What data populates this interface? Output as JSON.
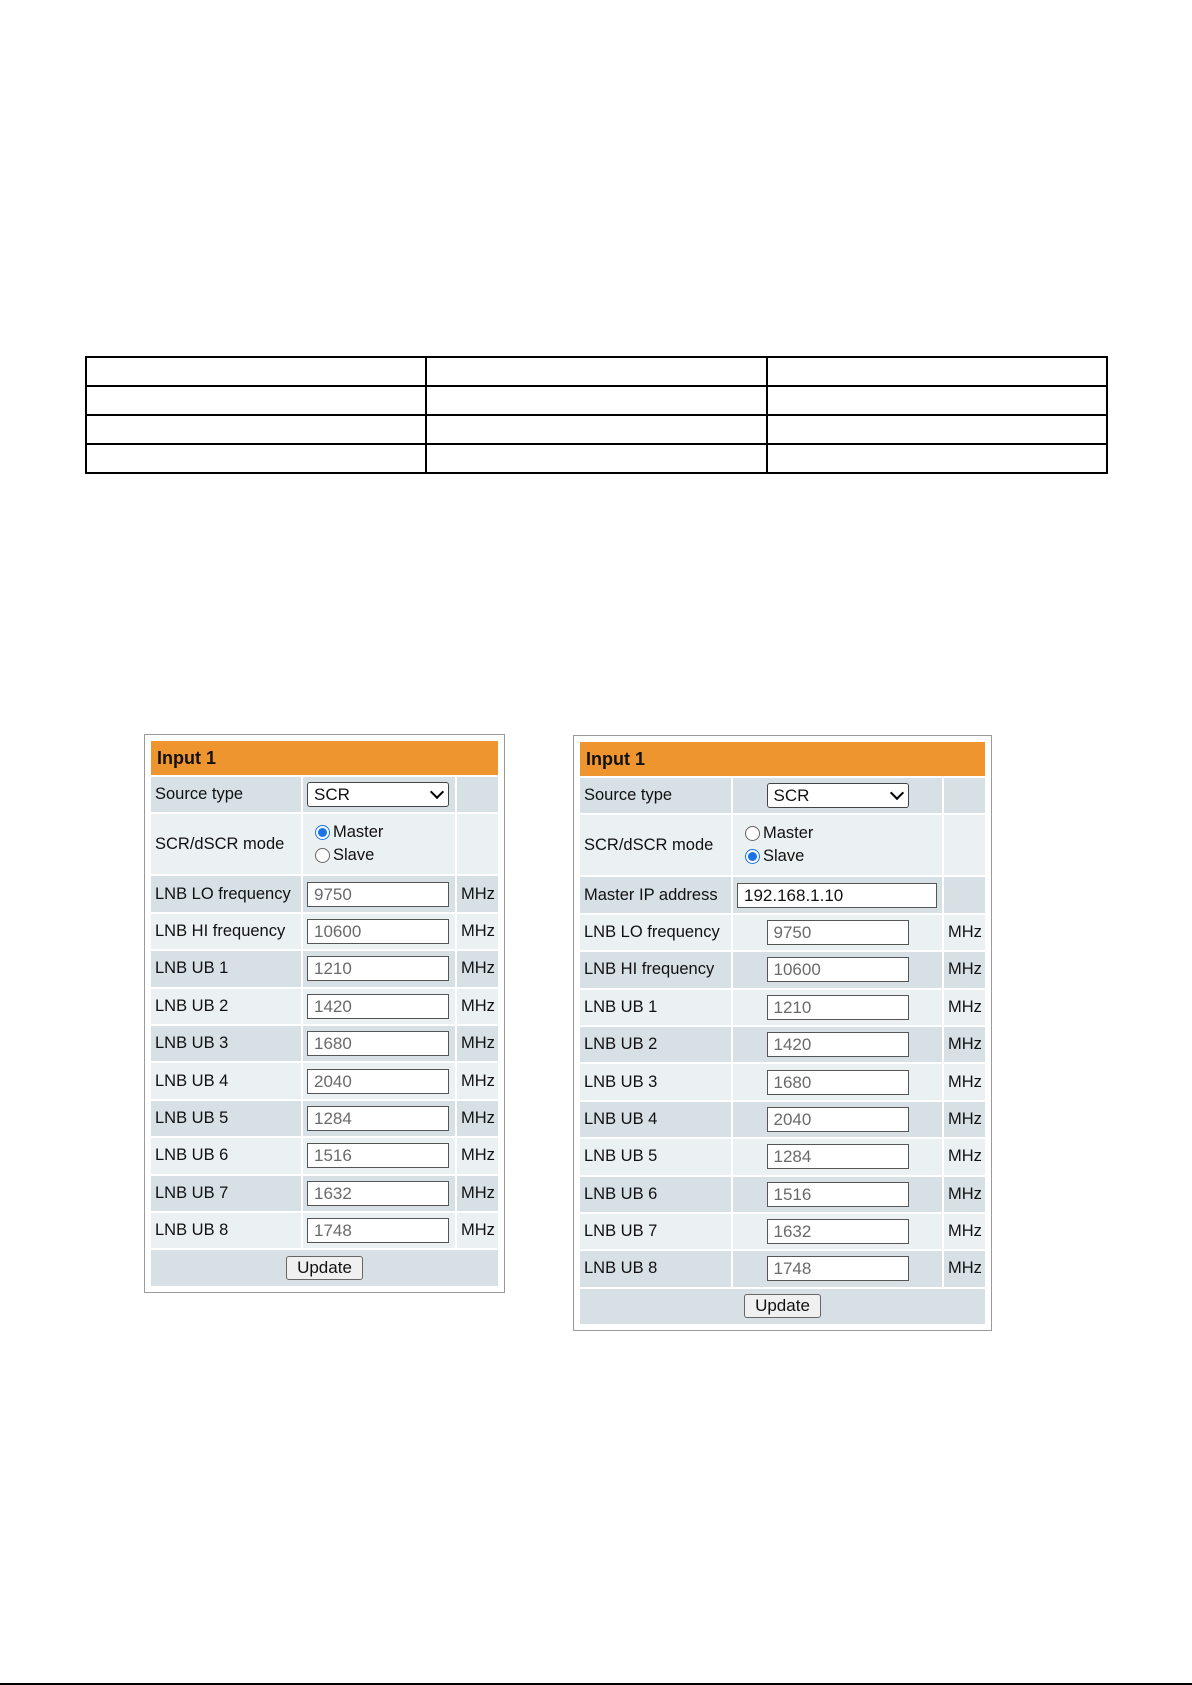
{
  "left_panel": {
    "title": "Input 1",
    "source_type": {
      "label": "Source type",
      "value": "SCR"
    },
    "mode": {
      "label": "SCR/dSCR mode",
      "options": [
        "Master",
        "Slave"
      ],
      "selected": "Master"
    },
    "rows": [
      {
        "label": "LNB LO frequency",
        "value": "9750",
        "unit": "MHz"
      },
      {
        "label": "LNB HI frequency",
        "value": "10600",
        "unit": "MHz"
      },
      {
        "label": "LNB UB 1",
        "value": "1210",
        "unit": "MHz"
      },
      {
        "label": "LNB UB 2",
        "value": "1420",
        "unit": "MHz"
      },
      {
        "label": "LNB UB 3",
        "value": "1680",
        "unit": "MHz"
      },
      {
        "label": "LNB UB 4",
        "value": "2040",
        "unit": "MHz"
      },
      {
        "label": "LNB UB 5",
        "value": "1284",
        "unit": "MHz"
      },
      {
        "label": "LNB UB 6",
        "value": "1516",
        "unit": "MHz"
      },
      {
        "label": "LNB UB 7",
        "value": "1632",
        "unit": "MHz"
      },
      {
        "label": "LNB UB 8",
        "value": "1748",
        "unit": "MHz"
      }
    ],
    "update_label": "Update"
  },
  "right_panel": {
    "title": "Input 1",
    "source_type": {
      "label": "Source type",
      "value": "SCR"
    },
    "mode": {
      "label": "SCR/dSCR mode",
      "options": [
        "Master",
        "Slave"
      ],
      "selected": "Slave"
    },
    "master_ip": {
      "label": "Master IP address",
      "value": "192.168.1.10"
    },
    "rows": [
      {
        "label": "LNB LO frequency",
        "value": "9750",
        "unit": "MHz"
      },
      {
        "label": "LNB HI frequency",
        "value": "10600",
        "unit": "MHz"
      },
      {
        "label": "LNB UB 1",
        "value": "1210",
        "unit": "MHz"
      },
      {
        "label": "LNB UB 2",
        "value": "1420",
        "unit": "MHz"
      },
      {
        "label": "LNB UB 3",
        "value": "1680",
        "unit": "MHz"
      },
      {
        "label": "LNB UB 4",
        "value": "2040",
        "unit": "MHz"
      },
      {
        "label": "LNB UB 5",
        "value": "1284",
        "unit": "MHz"
      },
      {
        "label": "LNB UB 6",
        "value": "1516",
        "unit": "MHz"
      },
      {
        "label": "LNB UB 7",
        "value": "1632",
        "unit": "MHz"
      },
      {
        "label": "LNB UB 8",
        "value": "1748",
        "unit": "MHz"
      }
    ],
    "update_label": "Update"
  },
  "colors": {
    "header": "#ee9530",
    "row_dark": "#d6e0e5",
    "row_light": "#ebf0f2",
    "radio_selected": "#1a73e8"
  }
}
